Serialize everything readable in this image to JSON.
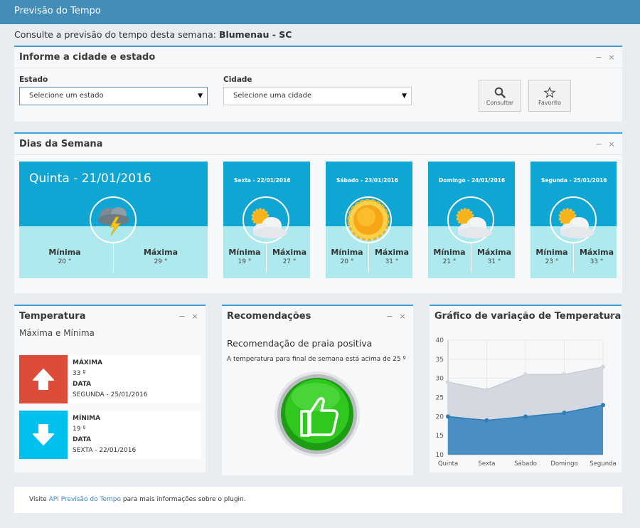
{
  "app": {
    "title": "Previsão do Tempo"
  },
  "subtitle": {
    "prefix": "Consulte a previsão do tempo desta semana:",
    "location": "Blumenau - SC"
  },
  "form_box": {
    "title": "Informe a cidade e estado",
    "estado_label": "Estado",
    "estado_value": "Selecione um estado",
    "cidade_label": "Cidade",
    "cidade_value": "Selecione uma cidade",
    "consultar_label": "Consultar",
    "favorito_label": "Favorito"
  },
  "days_box": {
    "title": "Dias da Semana",
    "min_label": "Mínima",
    "max_label": "Máxima",
    "days": [
      {
        "name": "Quinta - 21/01/2016",
        "min": "20 °",
        "max": "29 °",
        "icon": "storm-icon"
      },
      {
        "name": "Sexta - 22/01/2016",
        "min": "19 °",
        "max": "27 °",
        "icon": "partly-cloudy-icon"
      },
      {
        "name": "Sábado - 23/01/2016",
        "min": "20 °",
        "max": "31 °",
        "icon": "sun-icon"
      },
      {
        "name": "Domingo - 24/01/2016",
        "min": "21 °",
        "max": "31 °",
        "icon": "partly-cloudy-icon"
      },
      {
        "name": "Segunda - 25/01/2016",
        "min": "23 °",
        "max": "33 °",
        "icon": "partly-cloudy-icon"
      }
    ]
  },
  "temp_box": {
    "title": "Temperatura",
    "subtitle": "Máxima e Mínima",
    "max": {
      "label": "MÁXIMA",
      "value": "33 º",
      "date_label": "DATA",
      "date": "SEGUNDA - 25/01/2016"
    },
    "min": {
      "label": "MÍNIMA",
      "value": "19 º",
      "date_label": "DATA",
      "date": "SEXTA - 22/01/2016"
    },
    "colors": {
      "max": "#dd4b39",
      "min": "#00c0ef"
    }
  },
  "rec_box": {
    "title": "Recomendações",
    "headline": "Recomendação de praia positiva",
    "text": "A temperatura para final de semana está acima de 25 º",
    "icon": "thumbs-up-icon"
  },
  "chart_box": {
    "title": "Gráfico de variação de Temperatura"
  },
  "chart_data": {
    "type": "area",
    "categories": [
      "Quinta",
      "Sexta",
      "Sábado",
      "Domingo",
      "Segunda"
    ],
    "series": [
      {
        "values": [
          29,
          27,
          31,
          31,
          33
        ],
        "color": "#d4d8e0"
      },
      {
        "values": [
          20,
          19,
          20,
          21,
          23
        ],
        "color": "#4a8fc4"
      }
    ],
    "ylim": [
      10,
      40
    ],
    "yticks": [
      "40",
      "35",
      "30",
      "25",
      "20",
      "15",
      "10"
    ],
    "grid": true
  },
  "footer": {
    "prefix": "Visite",
    "link": "API Previsão do Tempo",
    "suffix": "para mais informações sobre o plugin."
  },
  "tools": {
    "minimize": "−",
    "close": "×"
  }
}
